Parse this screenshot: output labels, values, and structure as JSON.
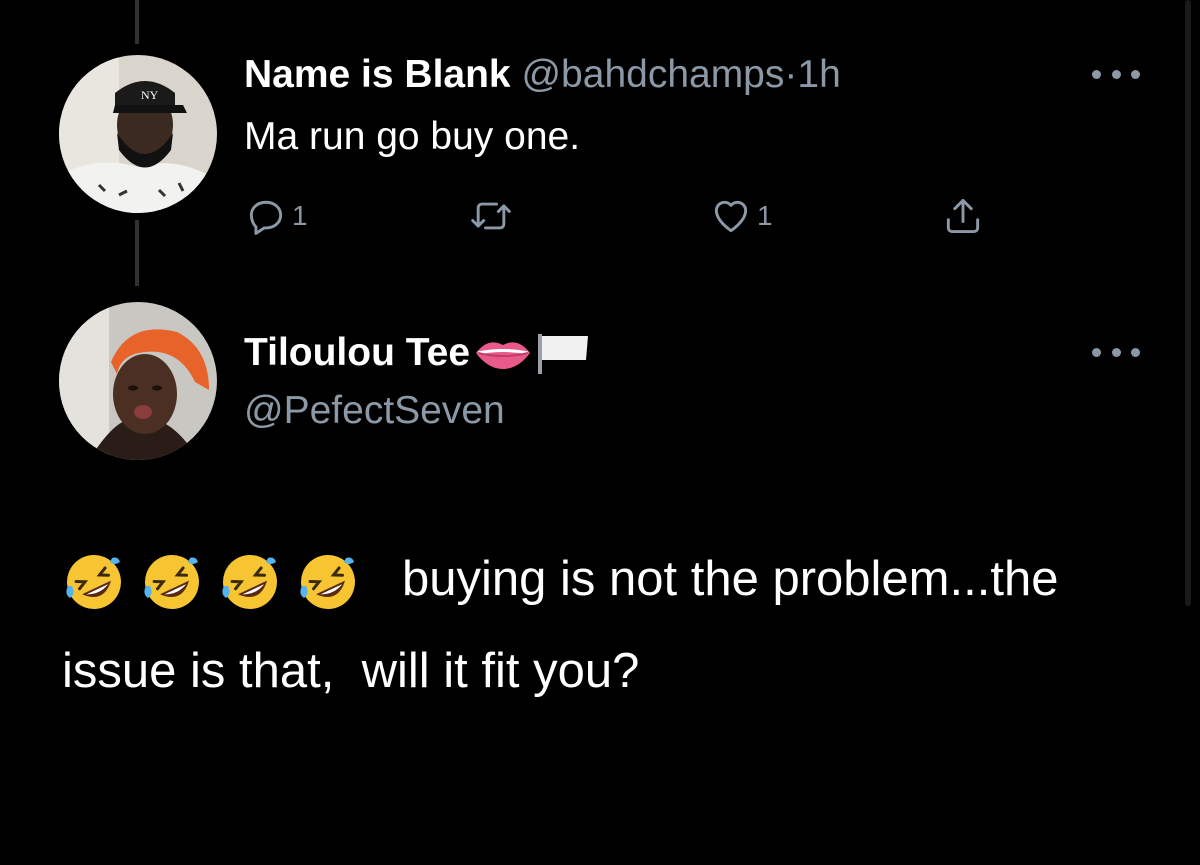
{
  "tweet1": {
    "display_name": "Name is Blank",
    "handle": "@bahdchamps",
    "separator": "·",
    "time": "1h",
    "text": "Ma run go buy one.",
    "reply_count": "1",
    "like_count": "1"
  },
  "tweet2": {
    "display_name": "Tiloulou Tee",
    "handle": "@PefectSeven",
    "text": "buying is not the problem...the issue is that,  will it fit you?"
  },
  "icons": {
    "reply": "reply-icon",
    "retweet": "retweet-icon",
    "like": "heart-icon",
    "share": "share-icon",
    "more": "more-icon",
    "name_emojis": [
      "lips-emoji",
      "white-flag-emoji"
    ],
    "tweet_emojis": [
      "rolling-on-floor-laughing-emoji",
      "rolling-on-floor-laughing-emoji",
      "rolling-on-floor-laughing-emoji",
      "rolling-on-floor-laughing-emoji"
    ]
  },
  "colors": {
    "background": "#000000",
    "primary_text": "#ffffff",
    "secondary_text": "#8b98a5",
    "thread_line": "#2f3336"
  }
}
